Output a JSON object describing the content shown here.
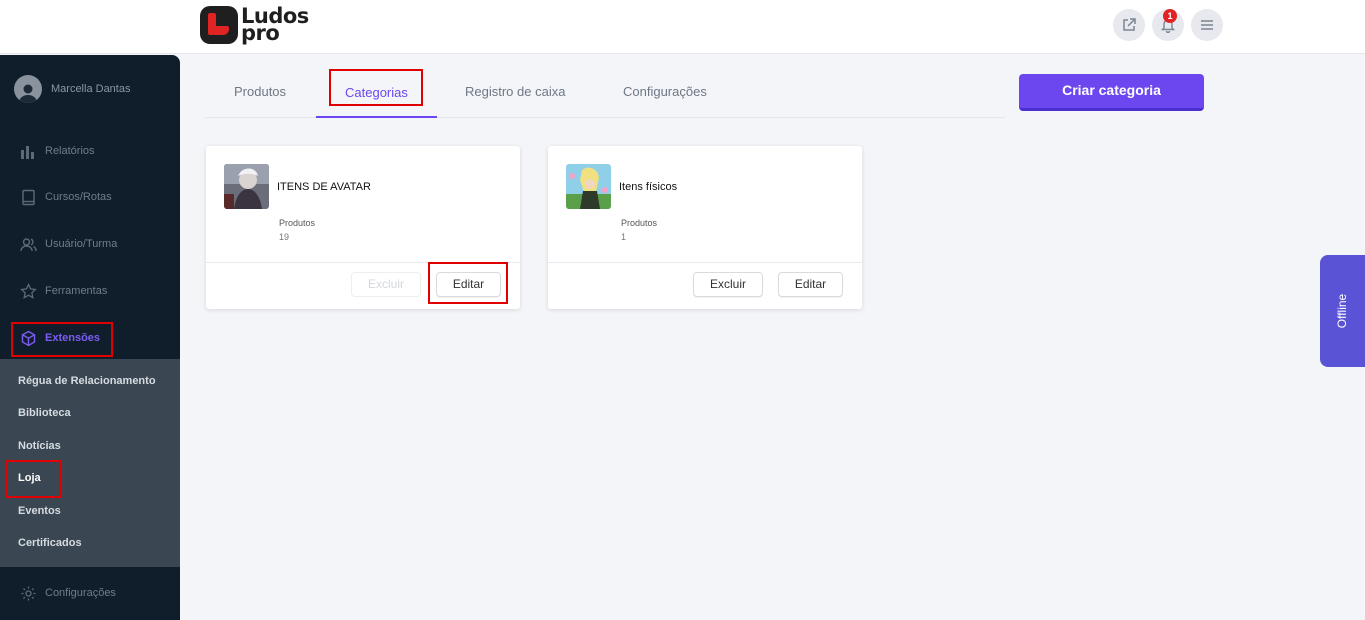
{
  "brand": {
    "logo_line1": "Ludos",
    "logo_line2": "pro"
  },
  "header": {
    "notification_count": "1"
  },
  "user": {
    "name": "Marcella Dantas"
  },
  "sidebar": {
    "items": [
      {
        "label": "Relatórios",
        "icon": "bar-chart-icon"
      },
      {
        "label": "Cursos/Rotas",
        "icon": "book-icon"
      },
      {
        "label": "Usuário/Turma",
        "icon": "users-icon"
      },
      {
        "label": "Ferramentas",
        "icon": "star-icon"
      },
      {
        "label": "Extensões",
        "icon": "cube-icon",
        "active": true
      }
    ],
    "submenu": [
      {
        "label": "Régua de Relacionamento"
      },
      {
        "label": "Biblioteca"
      },
      {
        "label": "Notícias"
      },
      {
        "label": "Loja",
        "current": true
      },
      {
        "label": "Eventos"
      },
      {
        "label": "Certificados"
      }
    ],
    "settings": {
      "label": "Configurações",
      "icon": "gear-icon"
    }
  },
  "tabs": [
    {
      "label": "Produtos"
    },
    {
      "label": "Categorias",
      "active": true
    },
    {
      "label": "Registro de caixa"
    },
    {
      "label": "Configurações"
    }
  ],
  "create_button": "Criar categoria",
  "categories": [
    {
      "name": "ITENS DE AVATAR",
      "products_label": "Produtos",
      "products_count": "19",
      "delete_label": "Excluir",
      "edit_label": "Editar",
      "delete_disabled": true
    },
    {
      "name": "Itens físicos",
      "products_label": "Produtos",
      "products_count": "1",
      "delete_label": "Excluir",
      "edit_label": "Editar",
      "delete_disabled": false
    }
  ],
  "offline_tab": "Offline",
  "colors": {
    "accent": "#6c47ef",
    "sidebar_bg": "#101e2c",
    "highlight": "#e00000",
    "offline_bg": "#5a53d6"
  }
}
